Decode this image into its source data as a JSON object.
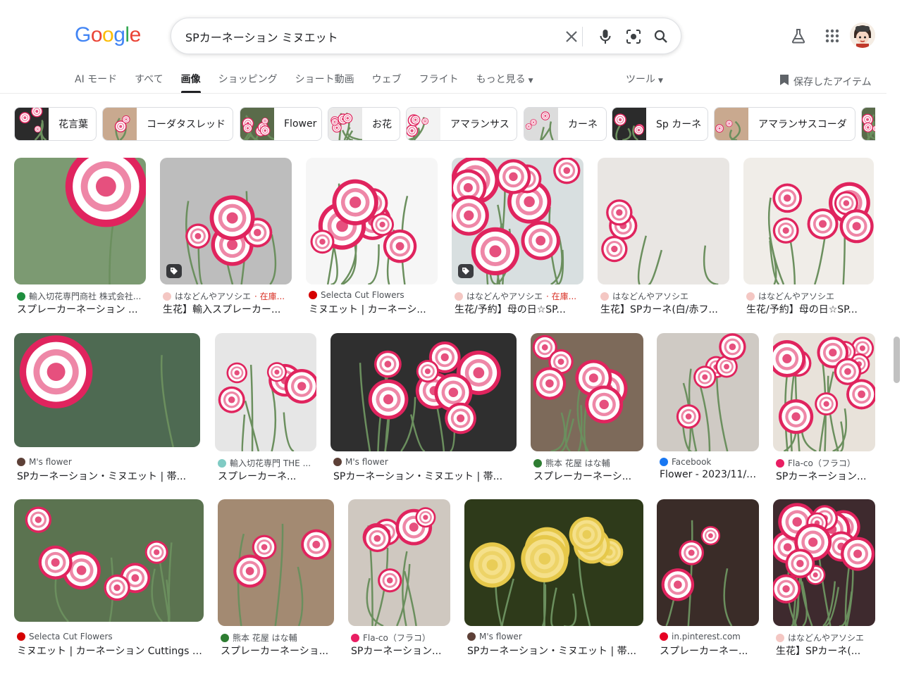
{
  "logo": {
    "letters": [
      "G",
      "o",
      "o",
      "g",
      "l",
      "e"
    ],
    "colors": [
      "#4285F4",
      "#EA4335",
      "#FBBC05",
      "#4285F4",
      "#34A853",
      "#EA4335"
    ]
  },
  "search": {
    "query": "SPカーネーション ミヌエット"
  },
  "icons": {
    "clear": "close-icon",
    "voice": "mic-icon",
    "lens": "lens-icon",
    "search": "search-icon",
    "labs": "flask-icon",
    "apps": "apps-grid-icon",
    "saved": "bookmark-icon"
  },
  "tabs": [
    {
      "label": "AI モード"
    },
    {
      "label": "すべて"
    },
    {
      "label": "画像",
      "active": true
    },
    {
      "label": "ショッピング"
    },
    {
      "label": "ショート動画"
    },
    {
      "label": "ウェブ"
    },
    {
      "label": "フライト"
    },
    {
      "label": "もっと見る",
      "dropdown": true
    }
  ],
  "tools_label": "ツール",
  "saved_label": "保存したアイテム",
  "chips": [
    {
      "label": "花言葉"
    },
    {
      "label": "コーダタスレッド"
    },
    {
      "label": "Flower"
    },
    {
      "label": "お花"
    },
    {
      "label": "アマランサス"
    },
    {
      "label": "カーネ"
    },
    {
      "label": "Sp カーネ"
    },
    {
      "label": "アマランサスコーダ"
    },
    {
      "label": ""
    }
  ],
  "results": [
    {
      "source": "輸入切花専門商社 株式会社...",
      "title": "スプレーカーネーション ...",
      "fav": "#1e8e3e"
    },
    {
      "source": "はなどんやアソシエ",
      "stock": "· 在庫...",
      "title": "生花】輸入スプレーカー...",
      "fav": "#f4c7c3",
      "tag": true
    },
    {
      "source": "Selecta Cut Flowers",
      "title": "ミヌエット | カーネーシ...",
      "fav": "#d50000"
    },
    {
      "source": "はなどんやアソシエ",
      "stock": "· 在庫...",
      "title": "生花/予約】母の日☆SP...",
      "fav": "#f4c7c3",
      "tag": true
    },
    {
      "source": "はなどんやアソシエ",
      "title": "生花】SPカーネ(白/赤フ...",
      "fav": "#f4c7c3"
    },
    {
      "source": "はなどんやアソシエ",
      "title": "生花/予約】母の日☆SP...",
      "fav": "#f4c7c3"
    },
    {
      "source": "M's flower",
      "title": "SPカーネーション・ミヌエット | 帯...",
      "fav": "#5d4037"
    },
    {
      "source": "輸入切花専門 THE ...",
      "title": "スプレーカーネ...",
      "fav": "#80cbc4"
    },
    {
      "source": "M's flower",
      "title": "SPカーネーション・ミヌエット | 帯...",
      "fav": "#5d4037"
    },
    {
      "source": "熊本 花屋 はな輔",
      "title": "スプレーカーネーシ...",
      "fav": "#2e7d32"
    },
    {
      "source": "Facebook",
      "title": "Flower - 2023/11/0...",
      "fav": "#1877f2"
    },
    {
      "source": "Fla-co（フラコ）",
      "title": "SPカーネーション...",
      "fav": "#e91e63"
    },
    {
      "source": "Selecta Cut Flowers",
      "title": "ミヌエット | カーネーション Cuttings |...",
      "fav": "#d50000"
    },
    {
      "source": "熊本 花屋 はな輔",
      "title": "スプレーカーネーショ...",
      "fav": "#2e7d32"
    },
    {
      "source": "Fla-co（フラコ）",
      "title": "SPカーネーション...",
      "fav": "#e91e63"
    },
    {
      "source": "M's flower",
      "title": "SPカーネーション・ミヌエット | 帯...",
      "fav": "#5d4037"
    },
    {
      "source": "in.pinterest.com",
      "title": "スプレーカーネー...",
      "fav": "#e60023"
    },
    {
      "source": "はなどんやアソシエ",
      "title": "生花】SPカーネ(...",
      "fav": "#f4c7c3"
    }
  ]
}
